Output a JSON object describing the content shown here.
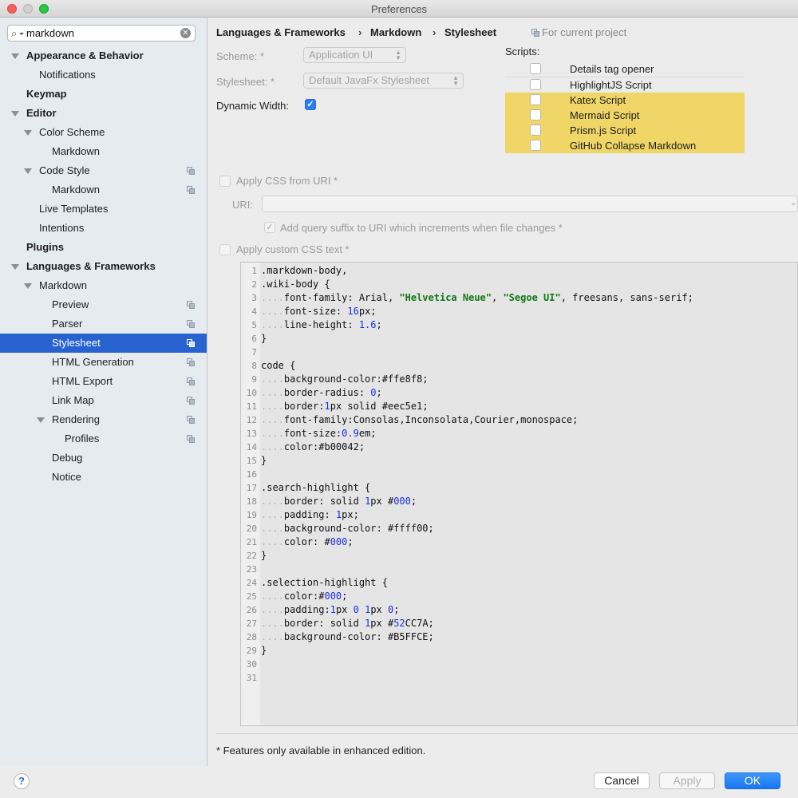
{
  "window": {
    "title": "Preferences"
  },
  "search": {
    "value": "markdown"
  },
  "sidebar": {
    "items": [
      {
        "label": "Appearance & Behavior"
      },
      {
        "label": "Notifications"
      },
      {
        "label": "Keymap"
      },
      {
        "label": "Editor"
      },
      {
        "label": "Color Scheme"
      },
      {
        "label": "Markdown"
      },
      {
        "label": "Code Style"
      },
      {
        "label": "Markdown"
      },
      {
        "label": "Live Templates"
      },
      {
        "label": "Intentions"
      },
      {
        "label": "Plugins"
      },
      {
        "label": "Languages & Frameworks"
      },
      {
        "label": "Markdown"
      },
      {
        "label": "Preview"
      },
      {
        "label": "Parser"
      },
      {
        "label": "Stylesheet"
      },
      {
        "label": "HTML Generation"
      },
      {
        "label": "HTML Export"
      },
      {
        "label": "Link Map"
      },
      {
        "label": "Rendering"
      },
      {
        "label": "Profiles"
      },
      {
        "label": "Debug"
      },
      {
        "label": "Notice"
      }
    ]
  },
  "breadcrumb": {
    "items": [
      "Languages & Frameworks",
      "Markdown",
      "Stylesheet"
    ],
    "separator": "›",
    "project_note": "For current project"
  },
  "form": {
    "scheme_label": "Scheme: *",
    "scheme_value": "Application UI",
    "stylesheet_label": "Stylesheet: *",
    "stylesheet_value": "Default JavaFx Stylesheet",
    "dynamic_width_label": "Dynamic Width:",
    "dynamic_width_checked": true,
    "apply_css_uri_label": "Apply CSS from URI *",
    "uri_label": "URI:",
    "uri_value": "",
    "query_suffix_label": "Add query suffix to URI which increments when file changes *",
    "apply_custom_css_label": "Apply custom CSS text *"
  },
  "scripts": {
    "label": "Scripts:",
    "items": [
      {
        "label": "Details tag opener",
        "checked": false,
        "highlighted": false
      },
      {
        "label": "HighlightJS Script",
        "checked": false,
        "highlighted": false
      },
      {
        "label": "Katex Script",
        "checked": false,
        "highlighted": true
      },
      {
        "label": "Mermaid Script",
        "checked": false,
        "highlighted": true
      },
      {
        "label": "Prism.js Script",
        "checked": false,
        "highlighted": true
      },
      {
        "label": "GitHub Collapse Markdown",
        "checked": false,
        "highlighted": true
      }
    ],
    "highlight_color": "#f0d666"
  },
  "css_code": [
    ".markdown-body,",
    ".wiki-body {",
    "    font-family: Arial, \"Helvetica Neue\", \"Segoe UI\", freesans, sans-serif;",
    "    font-size: 16px;",
    "    line-height: 1.6;",
    "}",
    "",
    "code {",
    "    background-color:#ffe8f8;",
    "    border-radius: 0;",
    "    border:1px solid #eec5e1;",
    "    font-family:Consolas,Inconsolata,Courier,monospace;",
    "    font-size:0.9em;",
    "    color:#b00042;",
    "}",
    "",
    ".search-highlight {",
    "    border: solid 1px #000;",
    "    padding: 1px;",
    "    background-color: #ffff00;",
    "    color: #000;",
    "}",
    "",
    ".selection-highlight {",
    "    color:#000;",
    "    padding:1px 0 1px 0;",
    "    border: solid 1px #52CC7A;",
    "    background-color: #B5FFCE;",
    "}",
    "",
    ""
  ],
  "footnote": "* Features only available in enhanced edition.",
  "footer": {
    "help_label": "?",
    "cancel_label": "Cancel",
    "apply_label": "Apply",
    "ok_label": "OK"
  },
  "colors": {
    "selection": "#2862d0",
    "primary_button": "#1a76f0",
    "checkbox_checked": "#2c7cf6"
  }
}
